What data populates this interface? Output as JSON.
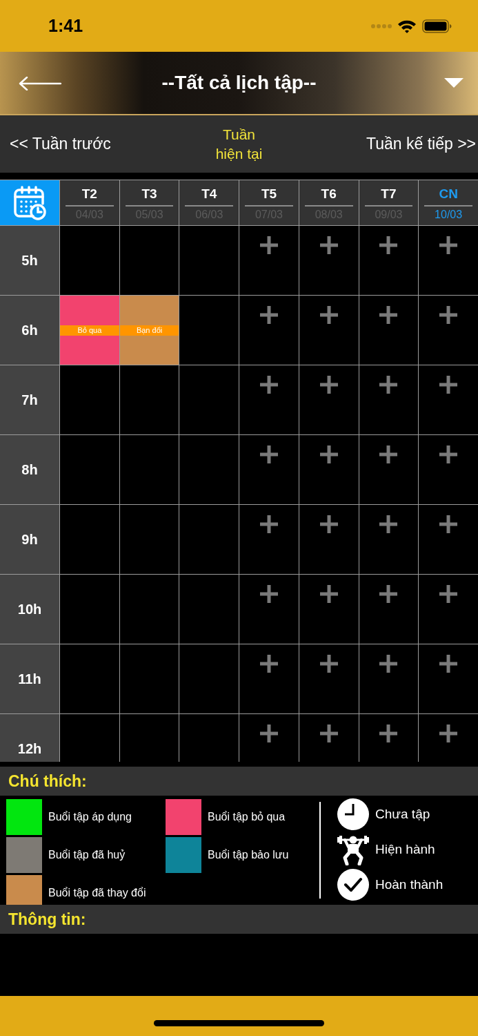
{
  "status_bar": {
    "time": "1:41"
  },
  "header": {
    "title": "--Tất cả lịch tập--"
  },
  "week_nav": {
    "previous": "<< Tuần trước",
    "current": "Tuần hiện tại",
    "next": "Tuần kế tiếp >>"
  },
  "calendar": {
    "days": [
      {
        "label": "T2",
        "date": "04/03",
        "selected": false
      },
      {
        "label": "T3",
        "date": "05/03",
        "selected": false
      },
      {
        "label": "T4",
        "date": "06/03",
        "selected": false
      },
      {
        "label": "T5",
        "date": "07/03",
        "selected": false
      },
      {
        "label": "T6",
        "date": "08/03",
        "selected": false
      },
      {
        "label": "T7",
        "date": "09/03",
        "selected": false
      },
      {
        "label": "CN",
        "date": "10/03",
        "selected": true
      }
    ],
    "hours": [
      {
        "label": "5h",
        "cells": [
          {
            "kind": "empty"
          },
          {
            "kind": "empty"
          },
          {
            "kind": "empty"
          },
          {
            "kind": "add"
          },
          {
            "kind": "add"
          },
          {
            "kind": "add"
          },
          {
            "kind": "add"
          }
        ]
      },
      {
        "label": "6h",
        "cells": [
          {
            "kind": "event",
            "label": "Bỏ qua",
            "color": "#f2436e"
          },
          {
            "kind": "event",
            "label": "Bạn đổi",
            "color": "#c98b4c"
          },
          {
            "kind": "empty"
          },
          {
            "kind": "add"
          },
          {
            "kind": "add"
          },
          {
            "kind": "add"
          },
          {
            "kind": "add"
          }
        ]
      },
      {
        "label": "7h",
        "cells": [
          {
            "kind": "empty"
          },
          {
            "kind": "empty"
          },
          {
            "kind": "empty"
          },
          {
            "kind": "add"
          },
          {
            "kind": "add"
          },
          {
            "kind": "add"
          },
          {
            "kind": "add"
          }
        ]
      },
      {
        "label": "8h",
        "cells": [
          {
            "kind": "empty"
          },
          {
            "kind": "empty"
          },
          {
            "kind": "empty"
          },
          {
            "kind": "add"
          },
          {
            "kind": "add"
          },
          {
            "kind": "add"
          },
          {
            "kind": "add"
          }
        ]
      },
      {
        "label": "9h",
        "cells": [
          {
            "kind": "empty"
          },
          {
            "kind": "empty"
          },
          {
            "kind": "empty"
          },
          {
            "kind": "add"
          },
          {
            "kind": "add"
          },
          {
            "kind": "add"
          },
          {
            "kind": "add"
          }
        ]
      },
      {
        "label": "10h",
        "cells": [
          {
            "kind": "empty"
          },
          {
            "kind": "empty"
          },
          {
            "kind": "empty"
          },
          {
            "kind": "add"
          },
          {
            "kind": "add"
          },
          {
            "kind": "add"
          },
          {
            "kind": "add"
          }
        ]
      },
      {
        "label": "11h",
        "cells": [
          {
            "kind": "empty"
          },
          {
            "kind": "empty"
          },
          {
            "kind": "empty"
          },
          {
            "kind": "add"
          },
          {
            "kind": "add"
          },
          {
            "kind": "add"
          },
          {
            "kind": "add"
          }
        ]
      },
      {
        "label": "12h",
        "cells": [
          {
            "kind": "empty"
          },
          {
            "kind": "empty"
          },
          {
            "kind": "empty"
          },
          {
            "kind": "add"
          },
          {
            "kind": "add"
          },
          {
            "kind": "add"
          },
          {
            "kind": "add"
          }
        ]
      }
    ]
  },
  "legend": {
    "title": "Chú thích:",
    "colors": [
      {
        "label": "Buổi tập áp dụng",
        "color": "#02e60f"
      },
      {
        "label": "Buổi tập đã huỷ",
        "color": "#7e7a74"
      },
      {
        "label": "Buổi tập đã thay đổi",
        "color": "#c98b4c"
      },
      {
        "label": "Buổi tập bỏ qua",
        "color": "#f2436e"
      },
      {
        "label": "Buổi tập bảo lưu",
        "color": "#0e8499"
      }
    ],
    "statuses": [
      {
        "kind": "pending",
        "label": "Chưa tập"
      },
      {
        "kind": "active",
        "label": "Hiện hành"
      },
      {
        "kind": "done",
        "label": "Hoàn thành"
      }
    ]
  },
  "info": {
    "title": "Thông tin:"
  }
}
